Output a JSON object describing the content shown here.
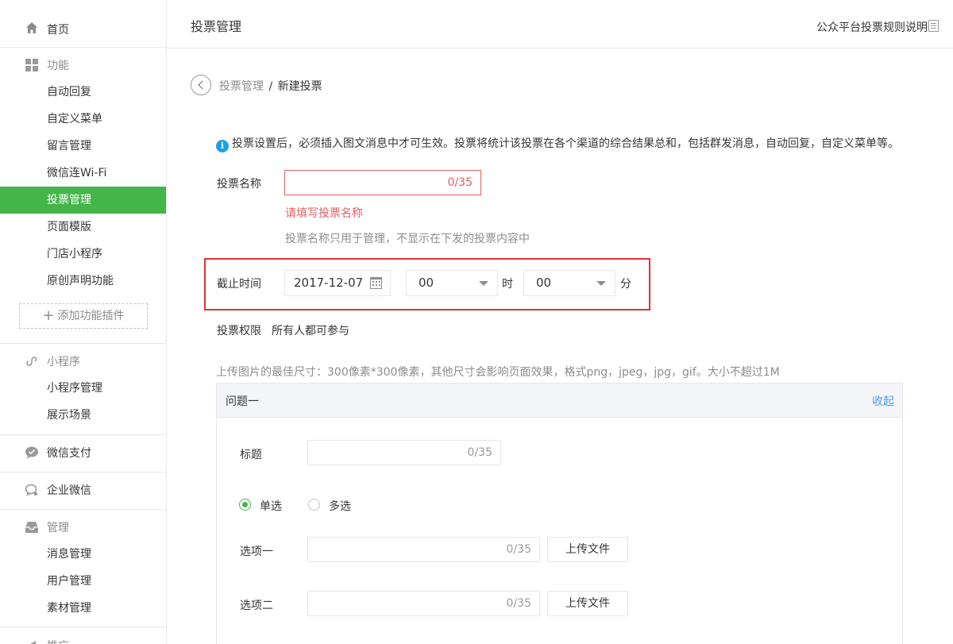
{
  "sidebar": {
    "home": "首页",
    "features": {
      "label": "功能",
      "items": [
        "自动回复",
        "自定义菜单",
        "留言管理",
        "微信连Wi-Fi",
        "投票管理",
        "页面模版",
        "门店小程序",
        "原创声明功能"
      ],
      "active": "投票管理",
      "add_plugin": "添加功能插件"
    },
    "mini_program": {
      "label": "小程序",
      "items": [
        "小程序管理",
        "展示场景"
      ]
    },
    "wechat_pay": "微信支付",
    "enterprise_wechat": "企业微信",
    "manage": {
      "label": "管理",
      "items": [
        "消息管理",
        "用户管理",
        "素材管理"
      ]
    },
    "promote": "推广"
  },
  "header": {
    "title": "投票管理",
    "rules_link": "公众平台投票规则说明"
  },
  "breadcrumb": {
    "parent": "投票管理",
    "separator": "/",
    "current": "新建投票"
  },
  "notice": "投票设置后，必须插入图文消息中才可生效。投票将统计该投票在各个渠道的综合结果总和，包括群发消息，自动回复，自定义菜单等。",
  "form": {
    "name_label": "投票名称",
    "name_value": "",
    "name_counter": "0/35",
    "name_error": "请填写投票名称",
    "name_hint": "投票名称只用于管理，不显示在下发的投票内容中",
    "deadline_label": "截止时间",
    "deadline_date": "2017-12-07",
    "deadline_hour": "00",
    "hour_unit": "时",
    "deadline_minute": "00",
    "minute_unit": "分",
    "permission_label": "投票权限",
    "permission_value": "所有人都可参与",
    "upload_tip": "上传图片的最佳尺寸：300像素*300像素，其他尺寸会影响页面效果，格式png，jpeg，jpg，gif。大小不超过1M"
  },
  "question": {
    "title": "问题一",
    "collapse": "收起",
    "title_label": "标题",
    "title_counter": "0/35",
    "single_choice": "单选",
    "multi_choice": "多选",
    "selected_mode": "单选",
    "options": [
      {
        "label": "选项一",
        "counter": "0/35",
        "upload": "上传文件"
      },
      {
        "label": "选项二",
        "counter": "0/35",
        "upload": "上传文件"
      }
    ]
  },
  "colors": {
    "accent_green": "#44b549",
    "error_red": "#e15f63",
    "highlight_red": "#e0303a",
    "link_blue": "#459ae9",
    "info_blue": "#1aa1e5"
  }
}
